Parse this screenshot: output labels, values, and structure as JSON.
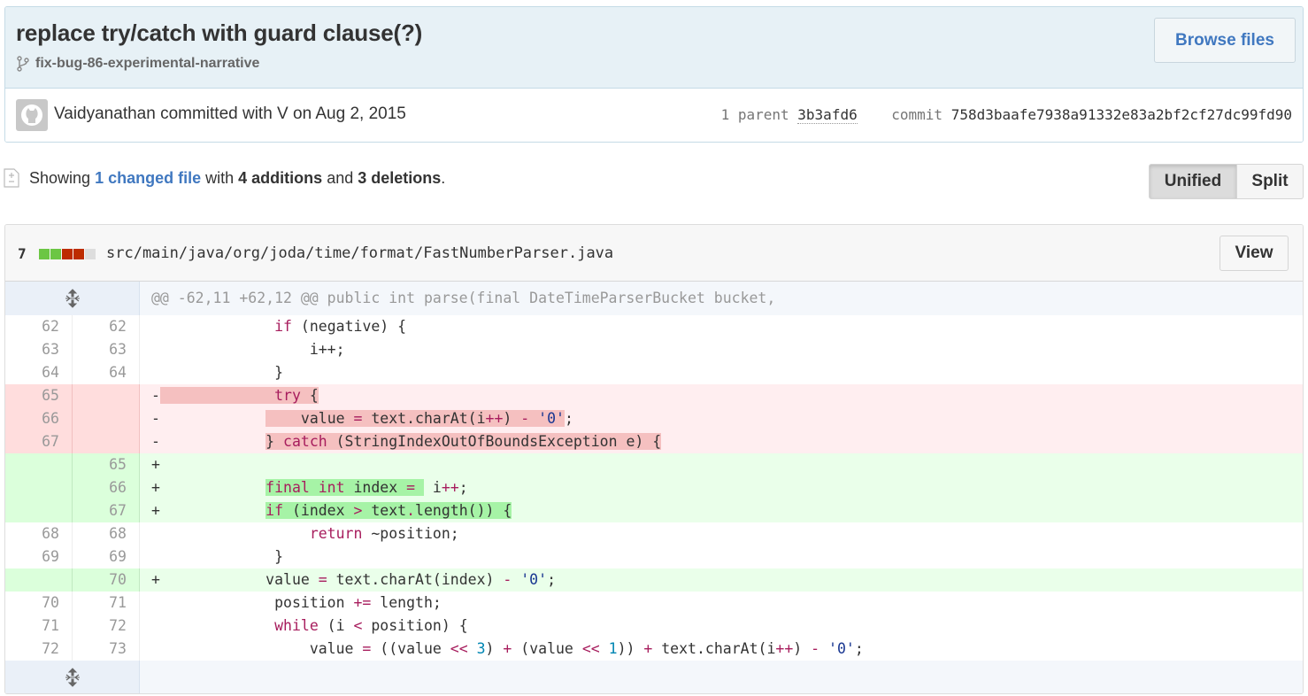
{
  "commit": {
    "title": "replace try/catch with guard clause(?)",
    "branch": "fix-bug-86-experimental-narrative",
    "browse_label": "Browse files",
    "author_line": "Vaidyanathan committed with V on Aug 2, 2015",
    "parent_label": "1 parent",
    "parent_sha": "3b3afd6",
    "commit_label": "commit",
    "commit_sha": "758d3baafe7938a91332e83a2bf2cf27dc99fd90"
  },
  "toc": {
    "showing": "Showing",
    "changed_link": "1 changed file",
    "with": "with",
    "additions": "4 additions",
    "and": "and",
    "deletions": "3 deletions",
    "period": "."
  },
  "view_toggle": {
    "unified": "Unified",
    "split": "Split"
  },
  "file": {
    "diffstat_count": "7",
    "diffstat_colors": [
      "#6cc644",
      "#6cc644",
      "#bd2c00",
      "#bd2c00",
      "#dddddd"
    ],
    "path": "src/main/java/org/joda/time/format/FastNumberParser.java",
    "view_label": "View",
    "hunk_header": "@@ -62,11 +62,12 @@ public int parse(final DateTimeParserBucket bucket,",
    "lines": [
      {
        "type": "ctx",
        "old": "62",
        "new": "62"
      },
      {
        "type": "ctx",
        "old": "63",
        "new": "63"
      },
      {
        "type": "ctx",
        "old": "64",
        "new": "64"
      },
      {
        "type": "del",
        "old": "65",
        "new": ""
      },
      {
        "type": "del",
        "old": "66",
        "new": ""
      },
      {
        "type": "del",
        "old": "67",
        "new": ""
      },
      {
        "type": "add",
        "old": "",
        "new": "65"
      },
      {
        "type": "add",
        "old": "",
        "new": "66"
      },
      {
        "type": "add",
        "old": "",
        "new": "67"
      },
      {
        "type": "ctx",
        "old": "68",
        "new": "68"
      },
      {
        "type": "ctx",
        "old": "69",
        "new": "69"
      },
      {
        "type": "add",
        "old": "",
        "new": "70"
      },
      {
        "type": "ctx",
        "old": "70",
        "new": "71"
      },
      {
        "type": "ctx",
        "old": "71",
        "new": "72"
      },
      {
        "type": "ctx",
        "old": "72",
        "new": "73"
      }
    ],
    "code": {
      "l0_a": "if",
      "l0_b": " (negative) {",
      "l1": "i++;",
      "l2": "}",
      "l3_kw": "try",
      "l3_b": " {",
      "l4_a": "value ",
      "l4_op": "=",
      "l4_b": " text.charAt(i",
      "l4_op2": "++",
      "l4_c": ") ",
      "l4_op3": "-",
      "l4_sp": " ",
      "l4_str": "'0'",
      "l4_end": ";",
      "l5_a": "} ",
      "l5_kw": "catch",
      "l5_b": " (StringIndexOutOfBoundsException e) {",
      "l6": "",
      "l7_kw1": "final",
      "l7_kw2": "int",
      "l7_a": " index ",
      "l7_op": "=",
      "l7_b": " i",
      "l7_op2": "++",
      "l7_c": ";",
      "l8_kw": "if",
      "l8_a": " (index ",
      "l8_op": ">",
      "l8_b": " text",
      "l8_op2": ".",
      "l8_c": "length()) {",
      "l9_kw": "return",
      "l9_a": " ~position;",
      "l10": "}",
      "l11_a": "value ",
      "l11_op": "=",
      "l11_b": " text.charAt(index) ",
      "l11_op2": "-",
      "l11_sp": " ",
      "l11_str": "'0'",
      "l11_end": ";",
      "l12_a": "position ",
      "l12_op": "+=",
      "l12_b": " length;",
      "l13_kw": "while",
      "l13_a": " (i ",
      "l13_op": "<",
      "l13_b": " position) {",
      "l14_a": "value ",
      "l14_op": "=",
      "l14_b": " ((value ",
      "l14_op2": "<<",
      "l14_sp": " ",
      "l14_n1": "3",
      "l14_c": ") ",
      "l14_op3": "+",
      "l14_d": " (value ",
      "l14_op4": "<<",
      "l14_sp2": " ",
      "l14_n2": "1",
      "l14_e": ")) ",
      "l14_op5": "+",
      "l14_f": " text.charAt(i",
      "l14_op6": "++",
      "l14_g": ") ",
      "l14_op7": "-",
      "l14_sp3": " ",
      "l14_str": "'0'",
      "l14_end": ";"
    }
  }
}
